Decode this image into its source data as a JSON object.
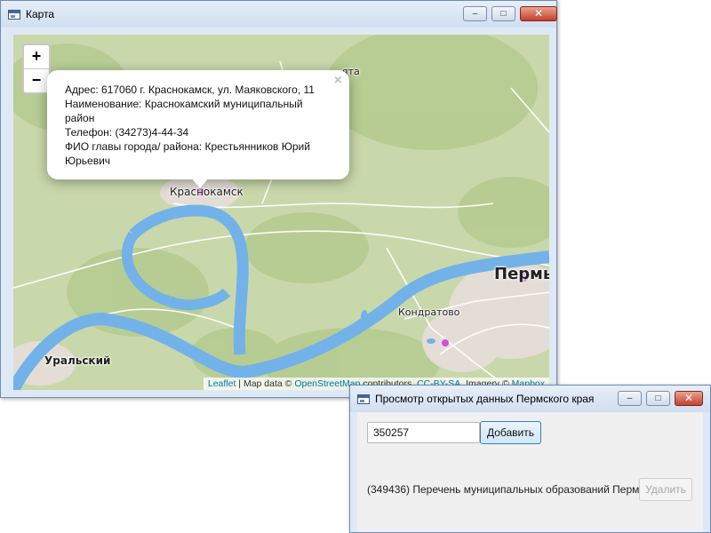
{
  "map_window": {
    "title": "Карта",
    "controls": {
      "minimize": "–",
      "maximize": "□",
      "close": "✕"
    },
    "zoom": {
      "in": "+",
      "out": "−"
    },
    "labels": {
      "krasnokamsk": "Краснокамск",
      "perm": "Пермь",
      "kondratovo": "Кондратово",
      "uralsky": "Уральский",
      "top_partial": "ята"
    },
    "popup": {
      "close": "×",
      "lines": [
        "Адрес: 617060 г. Краснокамск, ул. Маяковского, 11",
        "Наименование: Краснокамский муниципальный район",
        "Телефон: (34273)4-44-34",
        "ФИО главы города/ района: Крестьянников Юрий Юрьевич"
      ]
    },
    "attribution": {
      "leaflet": "Leaflet",
      "sep1": " | Map data © ",
      "osm": "OpenStreetMap",
      "contrib": " contributors, ",
      "license": "CC-BY-SA",
      "imagery": ", Imagery © ",
      "mapbox": "Mapbox"
    },
    "colors": {
      "river": "#72b2e8",
      "marker": "#d24fd6",
      "land": "#c9d8ab",
      "forest": "#b4cb8f",
      "urban": "#e3ddd6"
    }
  },
  "data_window": {
    "title": "Просмотр открытых данных Пермского края",
    "controls": {
      "minimize": "–",
      "maximize": "□",
      "close": "✕"
    },
    "input_value": "350257",
    "add_button": "Добавить",
    "item_text": "(349436) Перечень муниципальных образований Перм",
    "delete_button": "Удалить"
  }
}
